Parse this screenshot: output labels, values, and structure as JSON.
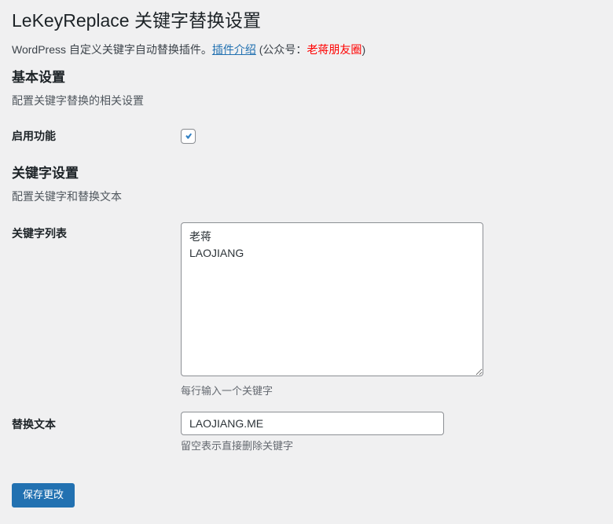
{
  "page": {
    "title": "LeKeyReplace 关键字替换设置",
    "subtitle": {
      "prefix": "WordPress 自定义关键字自动替换插件。",
      "link_label": "插件介绍",
      "mid": " (公众号：",
      "highlight": "老蒋朋友圈",
      "suffix": ")"
    }
  },
  "sections": {
    "basic": {
      "heading": "基本设置",
      "description": "配置关键字替换的相关设置"
    },
    "keywords": {
      "heading": "关键字设置",
      "description": "配置关键字和替换文本"
    }
  },
  "fields": {
    "enable": {
      "label": "启用功能",
      "checked": true
    },
    "keywords": {
      "label": "关键字列表",
      "value": "老蒋\nLAOJIANG",
      "hint": "每行输入一个关键字"
    },
    "replace": {
      "label": "替换文本",
      "value": "LAOJIANG.ME",
      "hint": "留空表示直接删除关键字"
    }
  },
  "toolbar": {
    "save_label": "保存更改"
  },
  "icons": {
    "checkmark": "check-icon"
  },
  "colors": {
    "background": "#f0f0f1",
    "heading_text": "#1d2327",
    "body_text": "#3c434a",
    "muted_text": "#646970",
    "link": "#2271b1",
    "highlight_red": "#ff0000",
    "checkbox_check": "#3582c4",
    "input_border": "#8c8f94",
    "button_bg": "#2271b1",
    "button_text": "#ffffff"
  }
}
